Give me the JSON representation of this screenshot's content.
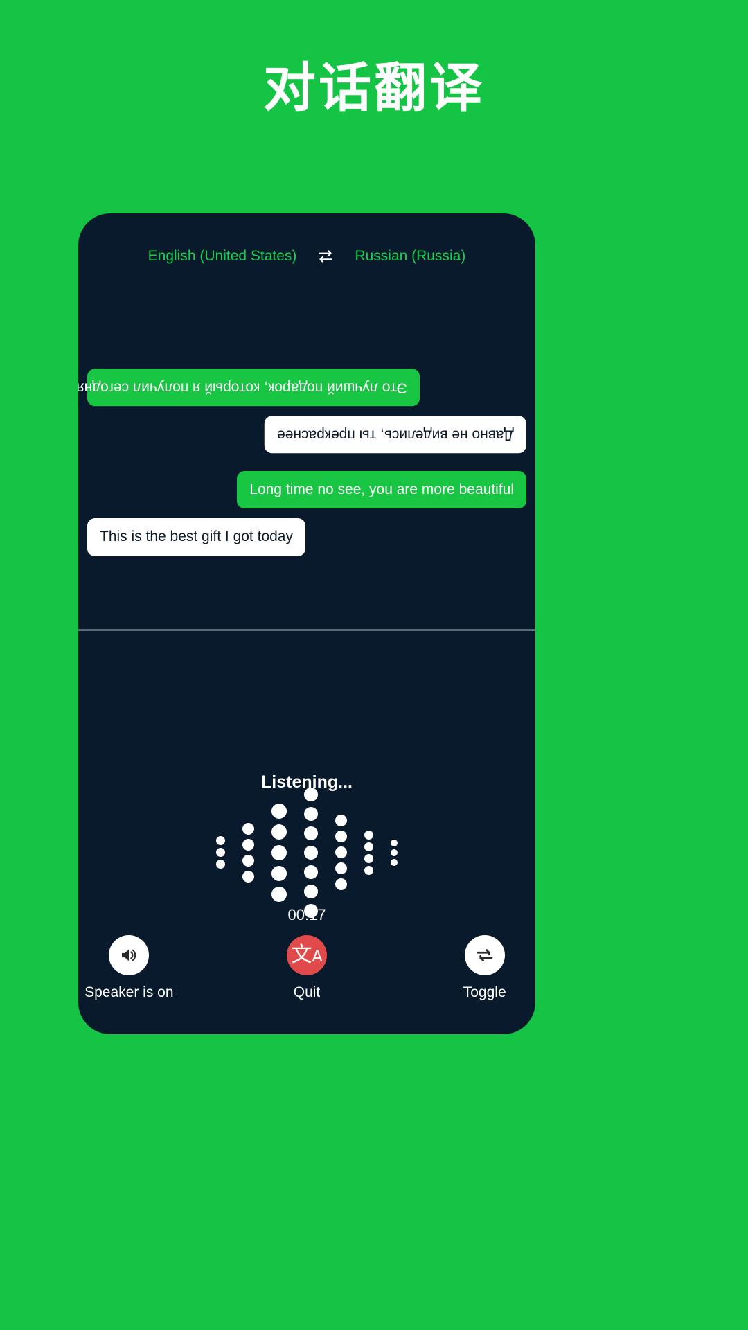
{
  "app": {
    "title": "对话翻译",
    "background_color": "#15c444",
    "panel_color": "#081a2b",
    "accent_green": "#18c644",
    "danger_red": "#e14a4a"
  },
  "language_bar": {
    "source_language": "English (United States)",
    "target_language": "Russian (Russia)",
    "swap_icon": "swap-horizontal-icon"
  },
  "conversation": {
    "remote_messages": [
      {
        "text": "Это лучший подарок, который я получил сегодня",
        "style": "green",
        "align": "left",
        "rotated": true
      },
      {
        "text": "Давно не виделись, ты прекраснее",
        "style": "white",
        "align": "right",
        "rotated": true
      }
    ],
    "local_messages": [
      {
        "text": "Long time no see, you are more beautiful",
        "style": "green",
        "align": "right",
        "rotated": false
      },
      {
        "text": "This is the best gift I got today",
        "style": "white",
        "align": "left",
        "rotated": false
      }
    ]
  },
  "status": {
    "listening_label": "Listening...",
    "timer": "00:17"
  },
  "waveform": {
    "columns": [
      {
        "dots": 3,
        "size": 13
      },
      {
        "dots": 4,
        "size": 17
      },
      {
        "dots": 5,
        "size": 22
      },
      {
        "dots": 7,
        "size": 20
      },
      {
        "dots": 5,
        "size": 17
      },
      {
        "dots": 4,
        "size": 13
      },
      {
        "dots": 3,
        "size": 10
      }
    ]
  },
  "controls": [
    {
      "label": "Speaker is on",
      "icon": "speaker-on-icon",
      "style": "light"
    },
    {
      "label": "Quit",
      "icon": "translate-icon",
      "style": "danger"
    },
    {
      "label": "Toggle",
      "icon": "repeat-icon",
      "style": "light"
    }
  ]
}
